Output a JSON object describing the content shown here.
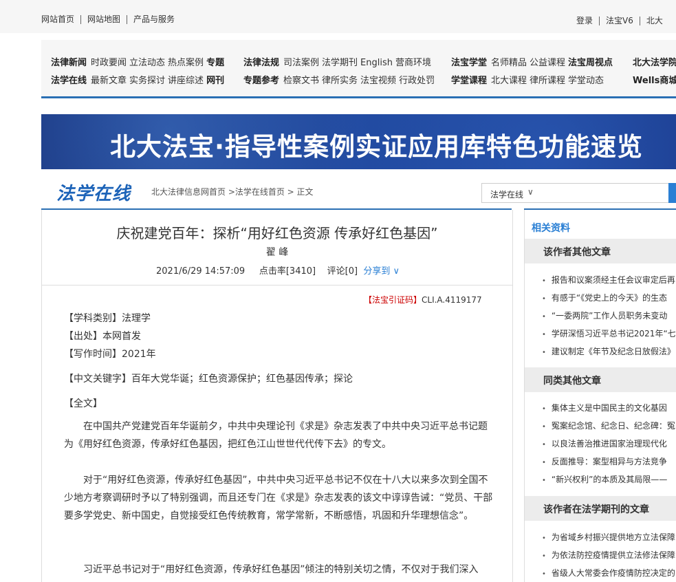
{
  "topbar": {
    "left": [
      "网站首页",
      "网站地图",
      "产品与服务"
    ],
    "right": [
      "登录",
      "法宝V6",
      "北大"
    ]
  },
  "nav": {
    "row1": [
      {
        "head": "法律新闻",
        "items": [
          "时政要闻",
          "立法动态",
          "热点案例",
          "专题"
        ]
      },
      {
        "head": "法律法规",
        "items": [
          "司法案例",
          "法学期刊",
          "English",
          "营商环境"
        ]
      },
      {
        "head": "法宝学堂",
        "items": [
          "名师精品",
          "公益课程",
          "法宝周视点"
        ]
      },
      {
        "head": "北大法学院",
        "items": []
      }
    ],
    "row2": [
      {
        "head": "法学在线",
        "items": [
          "最新文章",
          "实务探讨",
          "讲座综述",
          "网刊"
        ]
      },
      {
        "head": "专题参考",
        "items": [
          "检察文书",
          "律所实务",
          "法宝视频",
          "行政处罚"
        ]
      },
      {
        "head": "学堂课程",
        "items": [
          "北大课程",
          "律所课程",
          "学堂动态"
        ]
      },
      {
        "head": "Wells商城",
        "items": []
      }
    ]
  },
  "banner": {
    "title": "北大法宝·指导性案例实证应用库特色功能速览"
  },
  "logo": "法学在线",
  "breadcrumb": "北大法律信息网首页 >法学在线首页 > 正文",
  "search": {
    "select": "法学在线",
    "placeholder": ""
  },
  "article": {
    "title": "庆祝建党百年：探析“用好红色资源 传承好红色基因”",
    "author": "翟 峰",
    "date": "2021/6/29 14:57:09",
    "clicks": "点击率[3410]",
    "comments": "评论[0]",
    "share": "分享到 ∨",
    "cite_label": "【法宝引证码】",
    "cite_code": "CLI.A.4119177",
    "category": "【学科类别】法理学",
    "source": "【出处】本网首发",
    "written": "【写作时间】2021年",
    "keywords": "【中文关键字】百年大党华诞；红色资源保护；红色基因传承；探论",
    "fulltext": "【全文】",
    "p1": "在中国共产党建党百年华诞前夕，中共中央理论刊《求是》杂志发表了中共中央习近平总书记题为《用好红色资源，传承好红色基因，把红色江山世世代代传下去》的专文。",
    "p2": "对于“用好红色资源，传承好红色基因”，中共中央习近平总书记不仅在十八大以来多次到全国不少地方考察调研时予以了特别强调，而且还专门在《求是》杂志发表的该文中谆谆告诫：“党员、干部要多学党史、新中国史，自觉接受红色传统教育，常学常新，不断感悟，巩固和升华理想信念”。",
    "p3": "习近平总书记对于“用好红色资源，传承好红色基因”倾注的特别关切之情，不仅对于我们深入"
  },
  "sidebar": {
    "title": "相关资料",
    "sections": [
      {
        "title": "该作者其他文章",
        "items": [
          "报告和议案须经主任会议审定后再",
          "有感于“《党史上的今天》的生态",
          "“一委两院”工作人员职务未变动",
          "学研深悟习近平总书记2021年“七",
          "建议制定《年节及纪念日放假法》"
        ]
      },
      {
        "title": "同类其他文章",
        "items": [
          "集体主义是中国民主的文化基因",
          "冤案纪念馆、纪念日、纪念碑：冤",
          "以良法善治推进国家治理现代化",
          "反面推导：案型相异与方法竞争",
          "“新兴权利”的本质及其局限——"
        ]
      },
      {
        "title": "该作者在法学期刊的文章",
        "items": [
          "为省域乡村振兴提供地方立法保障",
          "为依法防控疫情提供立法修法保障",
          "省级人大常委会作疫情防控决定的"
        ]
      }
    ]
  }
}
